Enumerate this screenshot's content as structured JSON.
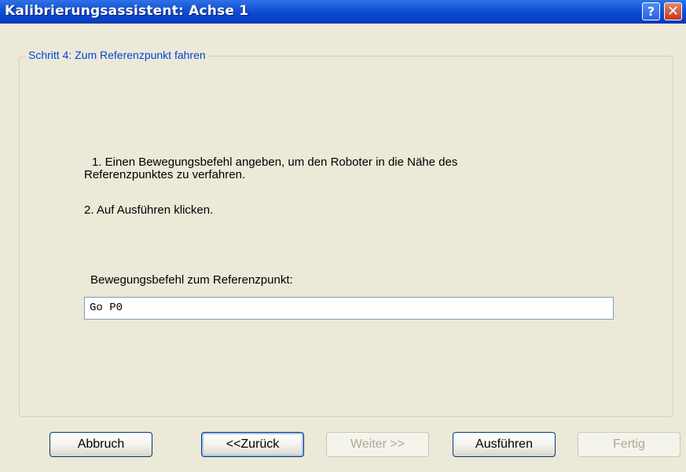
{
  "window": {
    "title": "Kalibrierungsassistent: Achse 1",
    "help_glyph": "?",
    "close_glyph": "✕"
  },
  "step": {
    "legend": "Schritt 4: Zum Referenzpunkt fahren",
    "instruction1_line1": "1. Einen Bewegungsbefehl angeben, um den Roboter in die Nähe des",
    "instruction1_line2": "Referenzpunktes zu verfahren.",
    "instruction2": "2. Auf Ausführen klicken.",
    "field_label": "Bewegungsbefehl zum Referenzpunkt:",
    "field_value": "Go P0"
  },
  "buttons": {
    "cancel": "Abbruch",
    "back": "<<Zurück",
    "next": "Weiter >>",
    "execute": "Ausführen",
    "finish": "Fertig"
  }
}
